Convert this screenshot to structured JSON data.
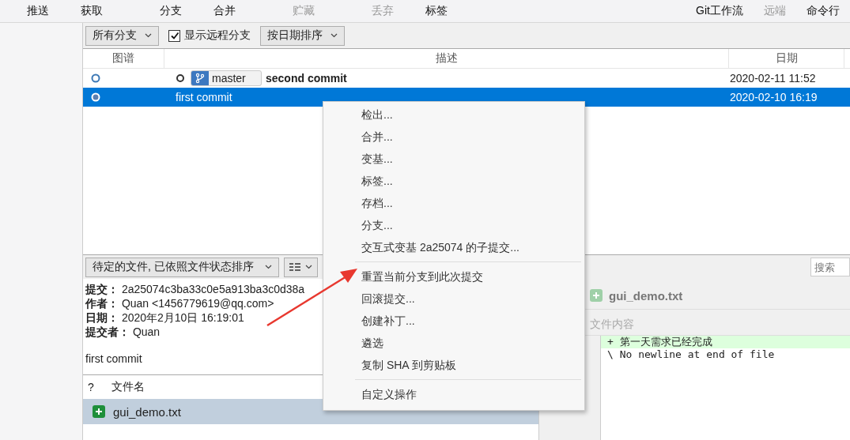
{
  "toolbar": {
    "groups": [
      [
        {
          "label": "推送",
          "disabled": false
        },
        {
          "label": "获取",
          "disabled": false
        }
      ],
      [
        {
          "label": "分支",
          "disabled": false
        },
        {
          "label": "合并",
          "disabled": false
        }
      ],
      [
        {
          "label": "贮藏",
          "disabled": true
        }
      ],
      [
        {
          "label": "丢弃",
          "disabled": true
        },
        {
          "label": "标签",
          "disabled": false
        }
      ]
    ],
    "right": [
      {
        "label": "Git工作流",
        "disabled": false
      },
      {
        "label": "远端",
        "disabled": true
      },
      {
        "label": "命令行",
        "disabled": false
      }
    ]
  },
  "filter_bar": {
    "branch_filter": "所有分支",
    "show_remote": {
      "label": "显示远程分支",
      "checked": true
    },
    "sort": "按日期排序"
  },
  "graph": {
    "columns": [
      "图谱",
      "描述",
      "日期"
    ],
    "rows": [
      {
        "branch": "master",
        "message": "second commit",
        "head": true,
        "date": "2020-02-11 11:52",
        "selected": false
      },
      {
        "message": "first commit",
        "head": false,
        "date": "2020-02-10 16:19",
        "selected": true
      }
    ]
  },
  "files_bar": {
    "sort": "待定的文件, 已依照文件状态排序",
    "search": {
      "placeholder": "搜索"
    }
  },
  "commit_details": {
    "fields": [
      {
        "label": "提交：",
        "value": "2a25074c3ba33c0e5a913ba3c0d38a"
      },
      {
        "label": "作者：",
        "value": "Quan <1456779619@qq.com>"
      },
      {
        "label": "日期：",
        "value": "2020年2月10日 16:19:01"
      },
      {
        "label": "提交者：",
        "value": "Quan"
      }
    ],
    "message": "first commit"
  },
  "file_list": {
    "columns": [
      "?",
      "文件名"
    ],
    "files": [
      {
        "name": "gui_demo.txt",
        "kind": "added",
        "selected": true
      }
    ]
  },
  "diff": {
    "file": "gui_demo.txt",
    "kind": "added",
    "section": "文件内容",
    "lines": [
      {
        "kind": "added",
        "text": "+ 第一天需求已经完成"
      },
      {
        "kind": "context",
        "text": "\\  No newline at end of file"
      }
    ]
  },
  "context_menu": {
    "items": [
      {
        "kind": "item",
        "label": "检出..."
      },
      {
        "kind": "item",
        "label": "合并..."
      },
      {
        "kind": "item",
        "label": "变基..."
      },
      {
        "kind": "item",
        "label": "标签..."
      },
      {
        "kind": "item",
        "label": "存档..."
      },
      {
        "kind": "item",
        "label": "分支..."
      },
      {
        "kind": "item",
        "label": "交互式变基 2a25074 的子提交..."
      },
      {
        "kind": "separator"
      },
      {
        "kind": "item",
        "label": "重置当前分支到此次提交"
      },
      {
        "kind": "item",
        "label": "回滚提交..."
      },
      {
        "kind": "item",
        "label": "创建补丁..."
      },
      {
        "kind": "item",
        "label": "遴选"
      },
      {
        "kind": "item",
        "label": "复制 SHA 到剪贴板"
      },
      {
        "kind": "separator"
      },
      {
        "kind": "item",
        "label": "自定义操作"
      }
    ]
  }
}
